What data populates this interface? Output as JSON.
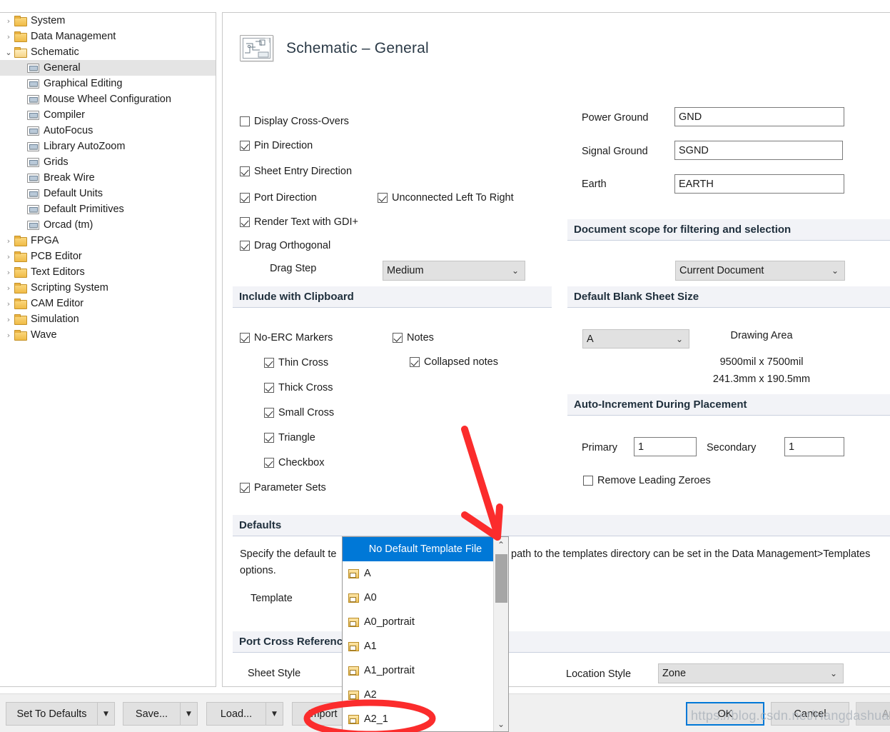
{
  "tree": {
    "items": [
      {
        "label": "System",
        "level": 0,
        "type": "folder",
        "state": "collapsed",
        "selected": false
      },
      {
        "label": "Data Management",
        "level": 0,
        "type": "folder",
        "state": "collapsed",
        "selected": false
      },
      {
        "label": "Schematic",
        "level": 0,
        "type": "folder",
        "state": "expanded",
        "selected": false
      },
      {
        "label": "General",
        "level": 1,
        "type": "page",
        "state": "leaf",
        "selected": true
      },
      {
        "label": "Graphical Editing",
        "level": 1,
        "type": "page",
        "state": "leaf",
        "selected": false
      },
      {
        "label": "Mouse Wheel Configuration",
        "level": 1,
        "type": "page",
        "state": "leaf",
        "selected": false
      },
      {
        "label": "Compiler",
        "level": 1,
        "type": "page",
        "state": "leaf",
        "selected": false
      },
      {
        "label": "AutoFocus",
        "level": 1,
        "type": "page",
        "state": "leaf",
        "selected": false
      },
      {
        "label": "Library AutoZoom",
        "level": 1,
        "type": "page",
        "state": "leaf",
        "selected": false
      },
      {
        "label": "Grids",
        "level": 1,
        "type": "page",
        "state": "leaf",
        "selected": false
      },
      {
        "label": "Break Wire",
        "level": 1,
        "type": "page",
        "state": "leaf",
        "selected": false
      },
      {
        "label": "Default Units",
        "level": 1,
        "type": "page",
        "state": "leaf",
        "selected": false
      },
      {
        "label": "Default Primitives",
        "level": 1,
        "type": "page",
        "state": "leaf",
        "selected": false
      },
      {
        "label": "Orcad (tm)",
        "level": 1,
        "type": "page",
        "state": "leaf",
        "selected": false
      },
      {
        "label": "FPGA",
        "level": 0,
        "type": "folder",
        "state": "collapsed",
        "selected": false
      },
      {
        "label": "PCB Editor",
        "level": 0,
        "type": "folder",
        "state": "collapsed",
        "selected": false
      },
      {
        "label": "Text Editors",
        "level": 0,
        "type": "folder",
        "state": "collapsed",
        "selected": false
      },
      {
        "label": "Scripting System",
        "level": 0,
        "type": "folder",
        "state": "collapsed",
        "selected": false
      },
      {
        "label": "CAM Editor",
        "level": 0,
        "type": "folder",
        "state": "collapsed",
        "selected": false
      },
      {
        "label": "Simulation",
        "level": 0,
        "type": "folder",
        "state": "collapsed",
        "selected": false
      },
      {
        "label": "Wave",
        "level": 0,
        "type": "folder",
        "state": "collapsed",
        "selected": false
      }
    ]
  },
  "header": {
    "title": "Schematic – General",
    "icon": "schematic-page-icon"
  },
  "options": {
    "display_cross_overs": {
      "label": "Display Cross-Overs",
      "checked": false
    },
    "pin_direction": {
      "label": "Pin Direction",
      "checked": true
    },
    "sheet_entry_direction": {
      "label": "Sheet Entry Direction",
      "checked": true
    },
    "port_direction": {
      "label": "Port Direction",
      "checked": true
    },
    "unconnected_left_to_right": {
      "label": "Unconnected Left To Right",
      "checked": true
    },
    "render_text_gdi": {
      "label": "Render Text with GDI+",
      "checked": true
    },
    "drag_orthogonal": {
      "label": "Drag Orthogonal",
      "checked": true
    },
    "drag_step": {
      "label": "Drag Step",
      "value": "Medium"
    }
  },
  "alias": {
    "power_ground": {
      "label": "Power Ground",
      "value": "GND"
    },
    "signal_ground": {
      "label": "Signal Ground",
      "value": "SGND"
    },
    "earth": {
      "label": "Earth",
      "value": "EARTH"
    }
  },
  "doc_scope": {
    "title": "Document scope for filtering and selection",
    "value": "Current Document"
  },
  "clipboard": {
    "title": "Include with Clipboard",
    "no_erc_markers": {
      "label": "No-ERC Markers",
      "checked": true
    },
    "thin_cross": {
      "label": "Thin Cross",
      "checked": true
    },
    "thick_cross": {
      "label": "Thick Cross",
      "checked": true
    },
    "small_cross": {
      "label": "Small Cross",
      "checked": true
    },
    "triangle": {
      "label": "Triangle",
      "checked": true
    },
    "checkbox": {
      "label": "Checkbox",
      "checked": true
    },
    "parameter_sets": {
      "label": "Parameter Sets",
      "checked": true
    },
    "notes": {
      "label": "Notes",
      "checked": true
    },
    "collapsed_notes": {
      "label": "Collapsed notes",
      "checked": true
    }
  },
  "sheet_size": {
    "title": "Default Blank Sheet Size",
    "value": "A",
    "drawing_area_label": "Drawing Area",
    "dimensions_mil": "9500mil x 7500mil",
    "dimensions_mm": "241.3mm x 190.5mm"
  },
  "auto_increment": {
    "title": "Auto-Increment During Placement",
    "primary_label": "Primary",
    "primary_value": "1",
    "secondary_label": "Secondary",
    "secondary_value": "1",
    "remove_leading_zeroes": {
      "label": "Remove Leading Zeroes",
      "checked": false
    }
  },
  "defaults": {
    "title": "Defaults",
    "description_line1": "Specify the default te",
    "description_mid": "path to the templates directory can be set in the Data Management>Templates",
    "description_line2": "options.",
    "template_label": "Template"
  },
  "template_dropdown": {
    "selected": "No Default Template File",
    "items": [
      {
        "label": "No Default Template File",
        "selected": true,
        "has_icon": false
      },
      {
        "label": "A",
        "selected": false,
        "has_icon": true
      },
      {
        "label": "A0",
        "selected": false,
        "has_icon": true
      },
      {
        "label": "A0_portrait",
        "selected": false,
        "has_icon": true
      },
      {
        "label": "A1",
        "selected": false,
        "has_icon": true
      },
      {
        "label": "A1_portrait",
        "selected": false,
        "has_icon": true
      },
      {
        "label": "A2",
        "selected": false,
        "has_icon": true
      },
      {
        "label": "A2_1",
        "selected": false,
        "has_icon": true
      }
    ],
    "scroll_up_icon": "chevron-up-icon",
    "scroll_down_icon": "chevron-down-icon"
  },
  "port_cross_ref": {
    "title": "Port Cross Reference",
    "sheet_style_label": "Sheet Style",
    "location_style_label": "Location Style",
    "location_style_value": "Zone"
  },
  "buttons": {
    "set_to_defaults": "Set To Defaults",
    "save": "Save...",
    "load": "Load...",
    "import": "Import",
    "ok": "OK",
    "cancel": "Cancel",
    "apply": "Apply"
  },
  "watermark": {
    "text": "https://blog.csdn.net/Hangdashuai"
  },
  "annotations": {
    "arrow_color": "#fb2c2c",
    "ellipse_color": "#fb2c2c",
    "arrow_name": "red-arrow-annotation",
    "ellipse_name": "red-ellipse-annotation"
  },
  "colors": {
    "accent": "#0078d7",
    "section_bg": "#f2f3f7",
    "section_border": "#c9d0de",
    "selected_tree": "#e4e4e4",
    "annotation_red": "#fb2c2c"
  }
}
